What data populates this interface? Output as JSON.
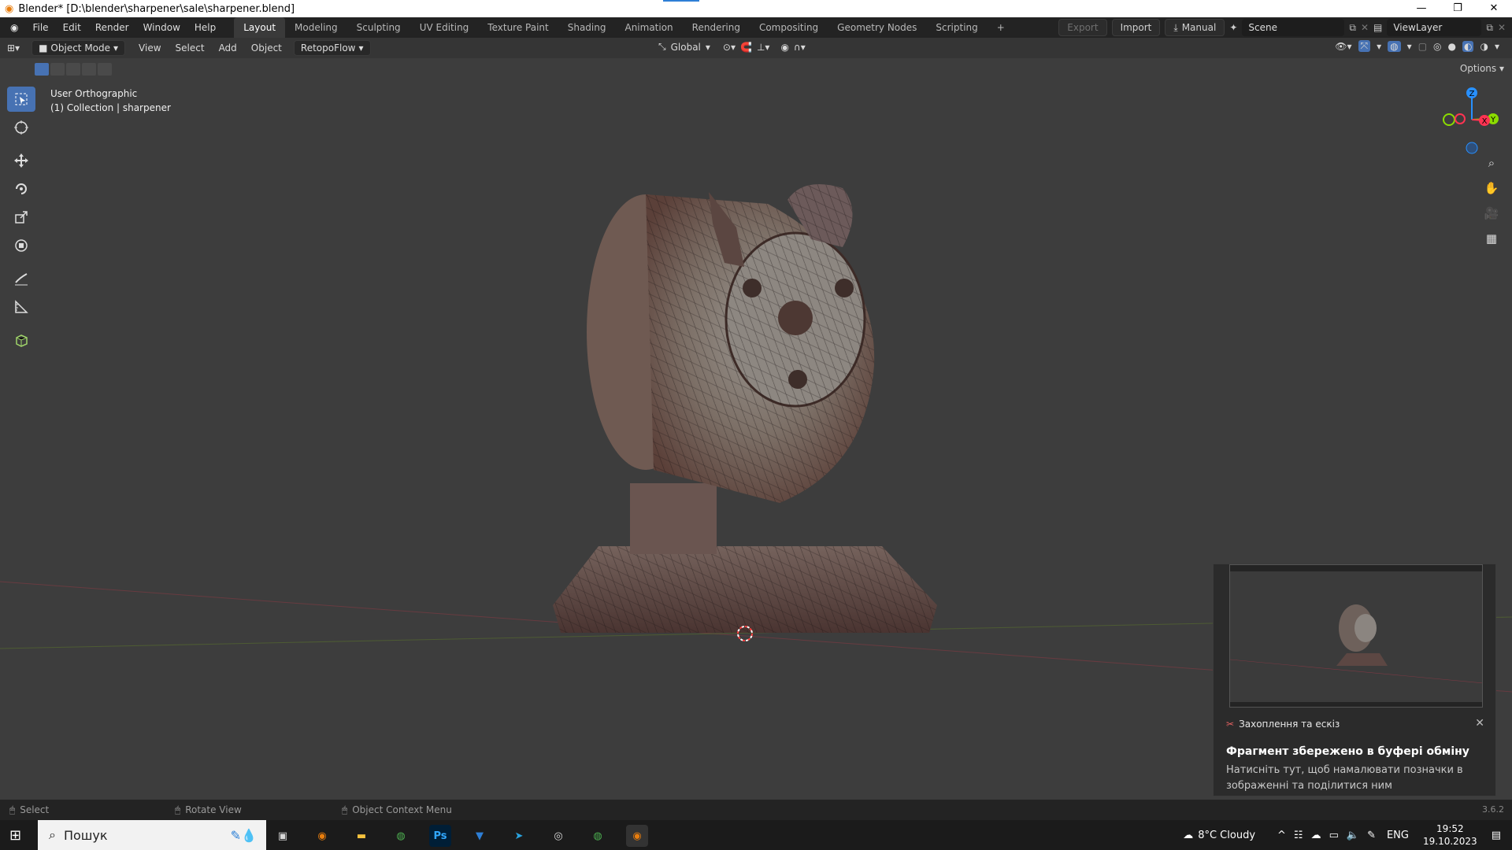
{
  "window": {
    "title": "Blender* [D:\\blender\\sharpener\\sale\\sharpener.blend]",
    "minimize": "—",
    "maximize": "❐",
    "close": "✕"
  },
  "menu": [
    "File",
    "Edit",
    "Render",
    "Window",
    "Help"
  ],
  "workspaces": [
    "Layout",
    "Modeling",
    "Sculpting",
    "UV Editing",
    "Texture Paint",
    "Shading",
    "Animation",
    "Rendering",
    "Compositing",
    "Geometry Nodes",
    "Scripting"
  ],
  "topright": {
    "export": "Export",
    "import": "Import",
    "manual": "Manual",
    "scene": "Scene",
    "viewlayer": "ViewLayer"
  },
  "header": {
    "mode": "Object Mode",
    "menus": [
      "View",
      "Select",
      "Add",
      "Object"
    ],
    "addon": "RetopoFlow",
    "orientation": "Global",
    "options": "Options"
  },
  "viewport": {
    "view_name": "User Orthographic",
    "collection": "(1) Collection | sharpener",
    "gizmo": {
      "z": "Z",
      "y": "Y",
      "x": "X"
    }
  },
  "status": {
    "select": "Select",
    "rotate": "Rotate View",
    "context": "Object Context Menu",
    "version": "3.6.2"
  },
  "taskbar": {
    "search_placeholder": "Пошук",
    "weather": "8°C  Cloudy",
    "lang": "ENG",
    "time": "19:52",
    "date": "19.10.2023"
  },
  "notification": {
    "app": "Захоплення та ескіз",
    "heading": "Фрагмент збережено в буфері обміну",
    "body": "Натисніть тут, щоб намалювати позначки в зображенні та поділитися ним"
  },
  "colors": {
    "accent": "#4772b3",
    "viewport_bg": "#3d3d3d",
    "x_axis": "#ff3352",
    "y_axis": "#8bdc00",
    "z_axis": "#2890ff"
  }
}
